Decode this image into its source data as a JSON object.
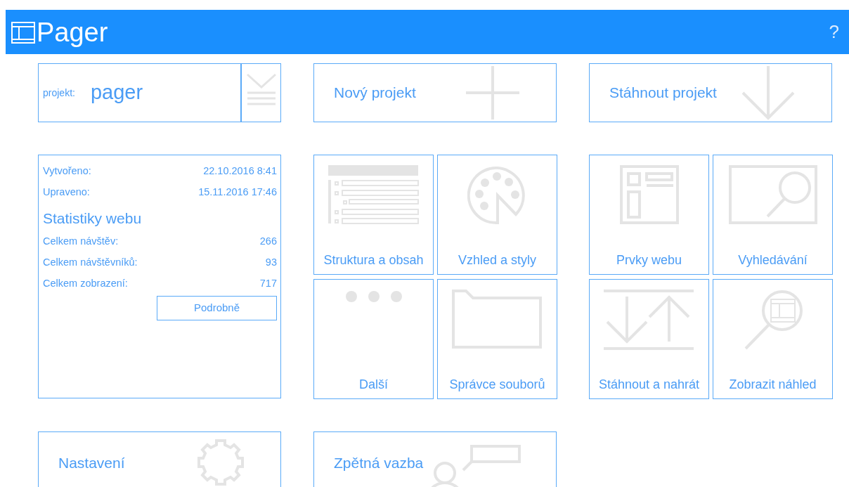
{
  "header": {
    "title": "Pager",
    "help": "?"
  },
  "project": {
    "label": "projekt:",
    "value": "pager"
  },
  "top_tiles": [
    {
      "kind": "plus",
      "label": "Nový projekt"
    },
    {
      "kind": "download",
      "label": "Stáhnout projekt"
    }
  ],
  "info": {
    "rows": [
      {
        "label": "Vytvořeno:",
        "value": "22.10.2016 8:41"
      },
      {
        "label": "Upraveno:",
        "value": "15.11.2016 17:46"
      }
    ],
    "stats_title": "Statistiky webu",
    "stats": [
      {
        "label": "Celkem návštěv:",
        "value": "266"
      },
      {
        "label": "Celkem návštěvníků:",
        "value": "93"
      },
      {
        "label": "Celkem zobrazení:",
        "value": "717"
      }
    ],
    "button": "Podrobně"
  },
  "tile_groups": [
    [
      {
        "kind": "structure",
        "label": "Struktura a obsah"
      },
      {
        "kind": "palette",
        "label": "Vzhled a styly"
      },
      {
        "kind": "dots",
        "label": "Další"
      },
      {
        "kind": "folder",
        "label": "Správce souborů"
      }
    ],
    [
      {
        "kind": "layout",
        "label": "Prvky webu"
      },
      {
        "kind": "search",
        "label": "Vyhledávání"
      },
      {
        "kind": "transfer",
        "label": "Stáhnout a nahrát"
      },
      {
        "kind": "preview",
        "label": "Zobrazit náhled"
      }
    ]
  ],
  "bottom_tiles": [
    {
      "kind": "gear",
      "label": "Nastavení"
    },
    {
      "kind": "feedback",
      "label": "Zpětná vazba"
    }
  ]
}
